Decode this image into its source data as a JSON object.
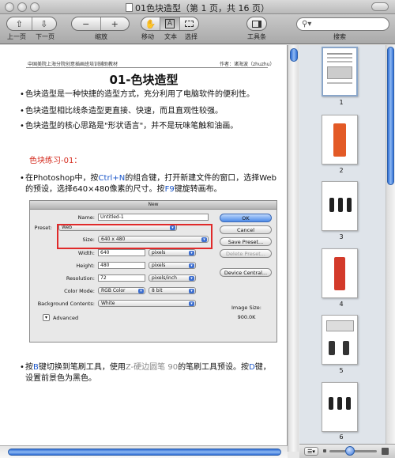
{
  "window": {
    "title": "01色块造型（第 1 页，共 16 页）"
  },
  "toolbar": {
    "prev_label": "上一页",
    "next_label": "下一页",
    "zoom_label": "缩放",
    "move_label": "移动",
    "text_label": "文本",
    "select_label": "选择",
    "toolbar_toggle_label": "工具条",
    "search_label": "搜索",
    "zoom_out_glyph": "−",
    "zoom_in_glyph": "+",
    "text_glyph": "A"
  },
  "page": {
    "header_left": "中国美院上海分院创意插画班培训辅助教材",
    "header_right": "作者：诸海波（zhuzhu）",
    "title": "01-色块造型",
    "bullets": [
      "色块造型是一种快捷的造型方式，充分利用了电脑软件的便利性。",
      "色块造型相比线条造型更直接、快速，而且直观性较强。",
      "色块造型的核心思路是\"形状语言\"，并不是玩味笔触和油画。"
    ],
    "exercise_title": "色块练习-01：",
    "step1": {
      "prefix": "在Photoshop中，按",
      "key1": "Ctrl+N",
      "mid": "的组合键，打开新建文件的窗口，选择Web的预设，选择640×480像素的尺寸。按",
      "key2": "F9",
      "suffix": "键旋转画布。"
    },
    "step2": {
      "prefix": "按",
      "key1": "B",
      "mid1": "键切换到笔刷工具，使用",
      "brush": "Z-硬边圆笔 90",
      "mid2": "的笔刷工具预设。按",
      "key2": "D",
      "suffix": "键，设置前景色为黑色。"
    }
  },
  "dialog": {
    "title": "New",
    "name_label": "Name:",
    "name_value": "Untitled-1",
    "preset_label": "Preset:",
    "preset_value": "Web",
    "size_label": "Size:",
    "size_value": "640 x 480",
    "width_label": "Width:",
    "width_value": "640",
    "width_unit": "pixels",
    "height_label": "Height:",
    "height_value": "480",
    "height_unit": "pixels",
    "resolution_label": "Resolution:",
    "resolution_value": "72",
    "resolution_unit": "pixels/inch",
    "color_mode_label": "Color Mode:",
    "color_mode_value": "RGB Color",
    "bit_value": "8 bit",
    "bg_label": "Background Contents:",
    "bg_value": "White",
    "advanced_label": "Advanced",
    "ok_label": "OK",
    "cancel_label": "Cancel",
    "save_preset_label": "Save Preset...",
    "delete_preset_label": "Delete Preset...",
    "device_central_label": "Device Central...",
    "image_size_label": "Image Size:",
    "image_size_value": "900.0K"
  },
  "thumbnails": [
    {
      "num": "1"
    },
    {
      "num": "2"
    },
    {
      "num": "3"
    },
    {
      "num": "4"
    },
    {
      "num": "5"
    },
    {
      "num": "6"
    }
  ],
  "colors": {
    "accent_blue": "#2f6ed6",
    "red_text": "#d42b1e",
    "highlight_box": "#e02a2a"
  }
}
